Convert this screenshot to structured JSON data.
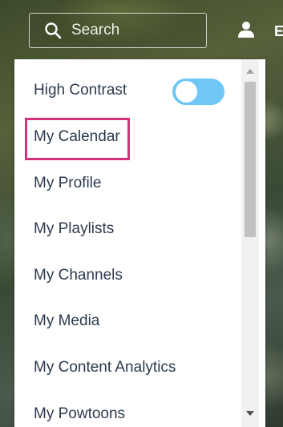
{
  "header": {
    "search_label": "Search",
    "user_initial": "E"
  },
  "menu": {
    "high_contrast_label": "High Contrast",
    "high_contrast_on": true,
    "items": [
      "My Calendar",
      "My Profile",
      "My Playlists",
      "My Channels",
      "My Media",
      "My Content Analytics",
      "My Powtoons"
    ],
    "highlighted_item": "My Calendar"
  },
  "colors": {
    "toggle_on": "#6fc7f6",
    "highlight_border": "#d6317c",
    "menu_text": "#2d3b4d"
  }
}
